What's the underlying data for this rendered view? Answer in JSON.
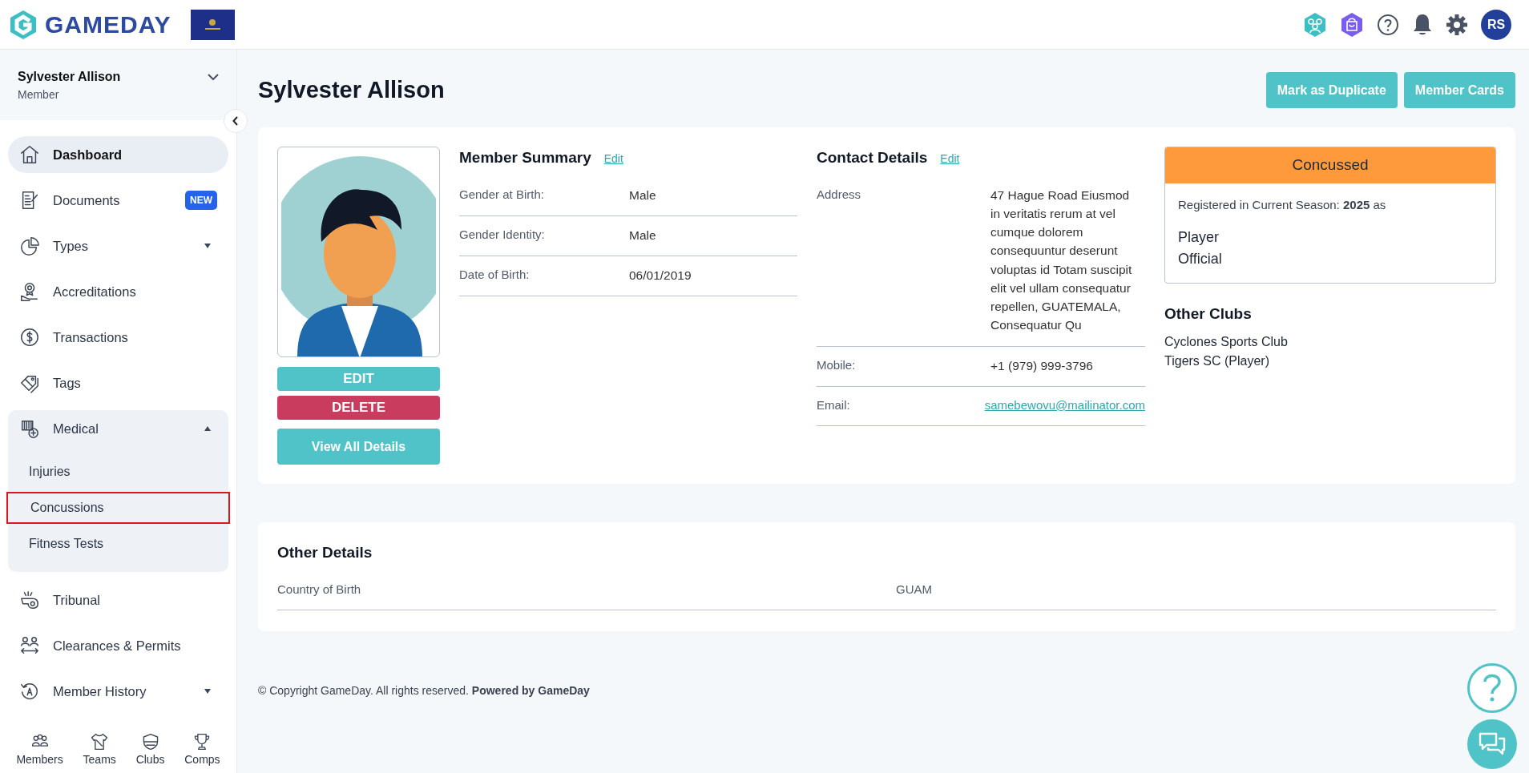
{
  "header": {
    "logo_text": "GAMEDAY",
    "avatar_initials": "RS"
  },
  "sidebar": {
    "user_name": "Sylvester Allison",
    "user_role": "Member",
    "items": [
      {
        "label": "Dashboard",
        "selected": true
      },
      {
        "label": "Documents",
        "badge": "NEW",
        "selected": false
      },
      {
        "label": "Types",
        "expanded": false,
        "selected": false
      },
      {
        "label": "Accreditations",
        "selected": false
      },
      {
        "label": "Transactions",
        "selected": false
      },
      {
        "label": "Tags",
        "selected": false
      },
      {
        "label": "Medical",
        "expanded": true,
        "selected": false,
        "children": [
          {
            "label": "Injuries",
            "highlighted": false
          },
          {
            "label": "Concussions",
            "highlighted": true
          },
          {
            "label": "Fitness Tests",
            "highlighted": false
          }
        ]
      },
      {
        "label": "Tribunal",
        "selected": false
      },
      {
        "label": "Clearances & Permits",
        "selected": false
      },
      {
        "label": "Member History",
        "expanded": false,
        "selected": false
      }
    ],
    "bottom_tabs": [
      {
        "label": "Members"
      },
      {
        "label": "Teams"
      },
      {
        "label": "Clubs"
      },
      {
        "label": "Comps"
      }
    ]
  },
  "page": {
    "title": "Sylvester Allison",
    "actions": [
      "Mark as Duplicate",
      "Member Cards"
    ]
  },
  "profile": {
    "buttons": [
      {
        "label": "EDIT",
        "kind": "edit"
      },
      {
        "label": "DELETE",
        "kind": "delete"
      },
      {
        "label": "View All Details",
        "kind": "view"
      }
    ]
  },
  "member_summary": {
    "title": "Member Summary",
    "edit_link": "Edit",
    "rows": [
      {
        "label": "Gender at Birth:",
        "value": "Male"
      },
      {
        "label": "Gender Identity:",
        "value": "Male"
      },
      {
        "label": "Date of Birth:",
        "value": "06/01/2019"
      }
    ]
  },
  "contact_details": {
    "title": "Contact Details",
    "edit_link": "Edit",
    "rows": [
      {
        "label": "Address",
        "value": "47 Hague Road Eiusmod in veritatis rerum at vel cumque dolorem consequuntur deserunt voluptas id Totam suscipit elit vel ullam consequatur repellen,  GUATEMALA, Consequatur Qu",
        "kind": "text"
      },
      {
        "label": "Mobile:",
        "value": "+1 (979) 999-3796",
        "kind": "text"
      },
      {
        "label": "Email:",
        "value": "samebewovu@mailinator.com",
        "kind": "link"
      }
    ]
  },
  "status": {
    "label": "Concussed",
    "registration": "Registered in Current Season: **2025** as",
    "roles": [
      "Player",
      "Official"
    ]
  },
  "other_clubs": {
    "title": "Other Clubs",
    "items": [
      "Cyclones Sports Club",
      "Tigers SC (Player)"
    ]
  },
  "other_details": {
    "title": "Other Details",
    "rows": [
      {
        "label": "Country of Birth",
        "value": "GUAM"
      }
    ]
  },
  "footer": "© Copyright GameDay. All rights reserved. **Powered by GameDay**"
}
